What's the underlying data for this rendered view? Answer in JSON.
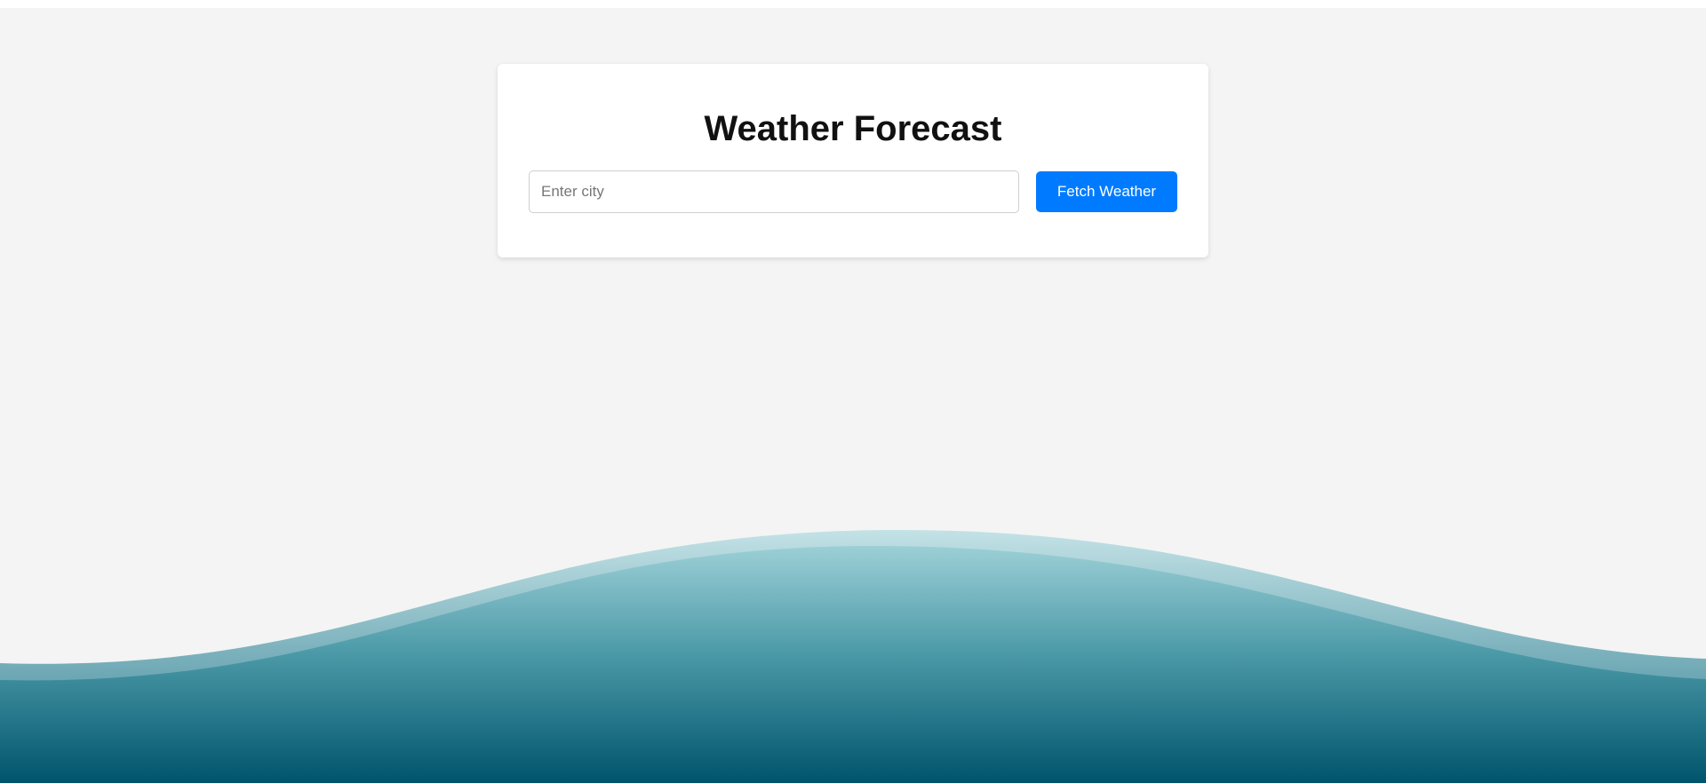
{
  "header": {
    "title": "Weather Forecast"
  },
  "search": {
    "placeholder": "Enter city",
    "value": "",
    "button_label": "Fetch Weather"
  },
  "colors": {
    "background": "#f4f4f4",
    "button": "#007bff",
    "wave_light": "#a8d5da",
    "wave_dark": "#00566f"
  }
}
